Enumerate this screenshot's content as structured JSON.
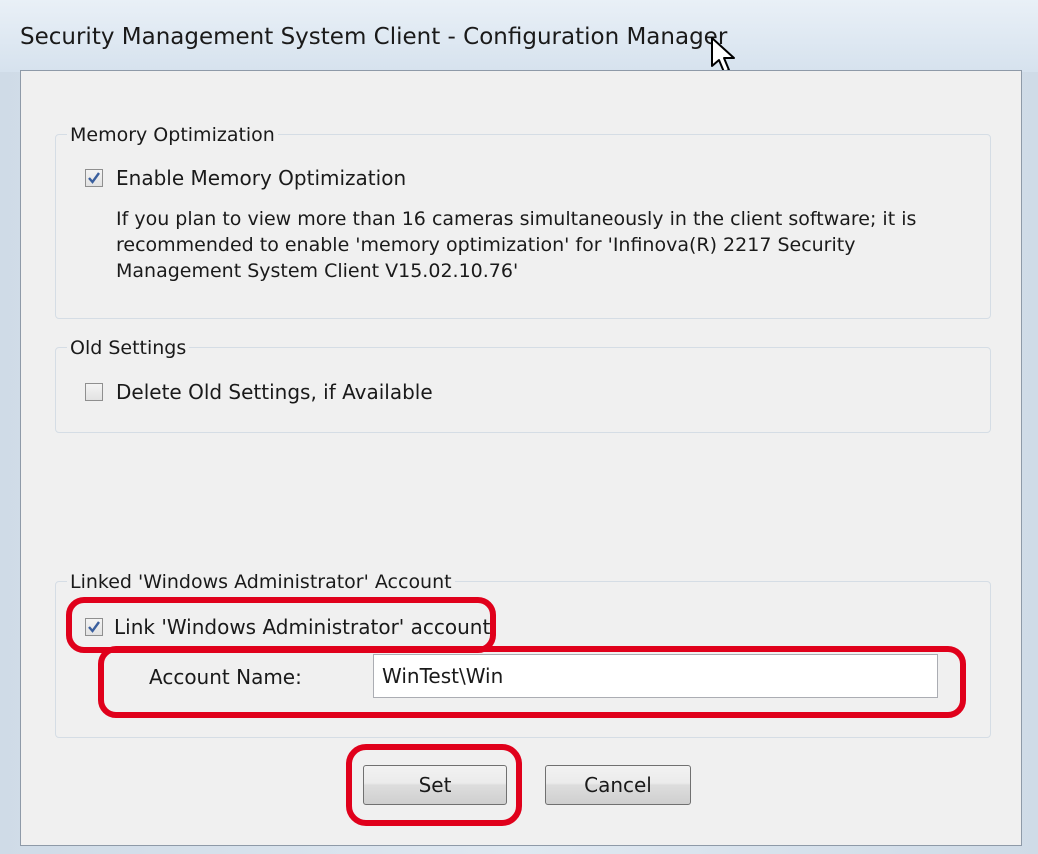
{
  "window": {
    "title": "Security Management System Client - Configuration Manager"
  },
  "memory_group": {
    "legend": "Memory Optimization",
    "checkbox_label": "Enable Memory Optimization",
    "checked": true,
    "description": "If you plan to view more than 16 cameras simultaneously in the client software; it is recommended to enable 'memory optimization' for 'Infinova(R) 2217 Security Management System Client V15.02.10.76'"
  },
  "old_settings_group": {
    "legend": "Old Settings",
    "checkbox_label": "Delete Old Settings, if Available",
    "checked": false
  },
  "linked_group": {
    "legend": "Linked 'Windows Administrator' Account",
    "checkbox_label": "Link 'Windows Administrator' account",
    "checked": true,
    "account_label": "Account Name:",
    "account_value": "WinTest\\Win"
  },
  "buttons": {
    "set_label": "Set",
    "cancel_label": "Cancel"
  },
  "colors": {
    "highlight": "#e0001b",
    "check": "#3a5f9e"
  }
}
